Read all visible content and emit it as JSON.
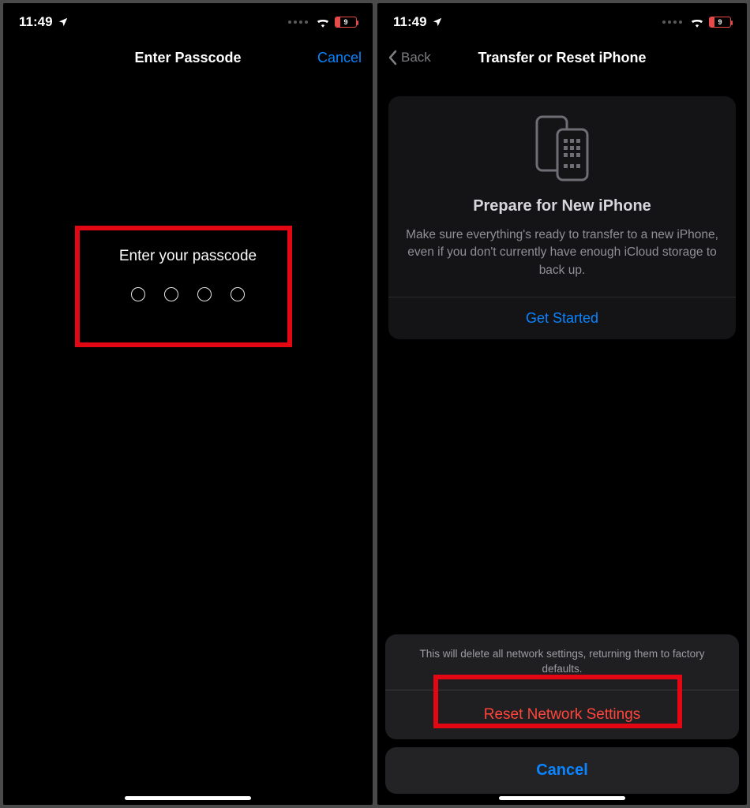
{
  "status": {
    "time": "11:49",
    "battery_text": "9"
  },
  "left_screen": {
    "nav_title": "Enter Passcode",
    "nav_cancel": "Cancel",
    "prompt": "Enter your passcode"
  },
  "right_screen": {
    "nav_back": "Back",
    "nav_title": "Transfer or Reset iPhone",
    "card": {
      "title": "Prepare for New iPhone",
      "desc": "Make sure everything's ready to transfer to a new iPhone, even if you don't currently have enough iCloud storage to back up.",
      "get_started": "Get Started"
    },
    "sheet": {
      "message": "This will delete all network settings, returning them to factory defaults.",
      "action": "Reset Network Settings",
      "cancel": "Cancel"
    }
  }
}
